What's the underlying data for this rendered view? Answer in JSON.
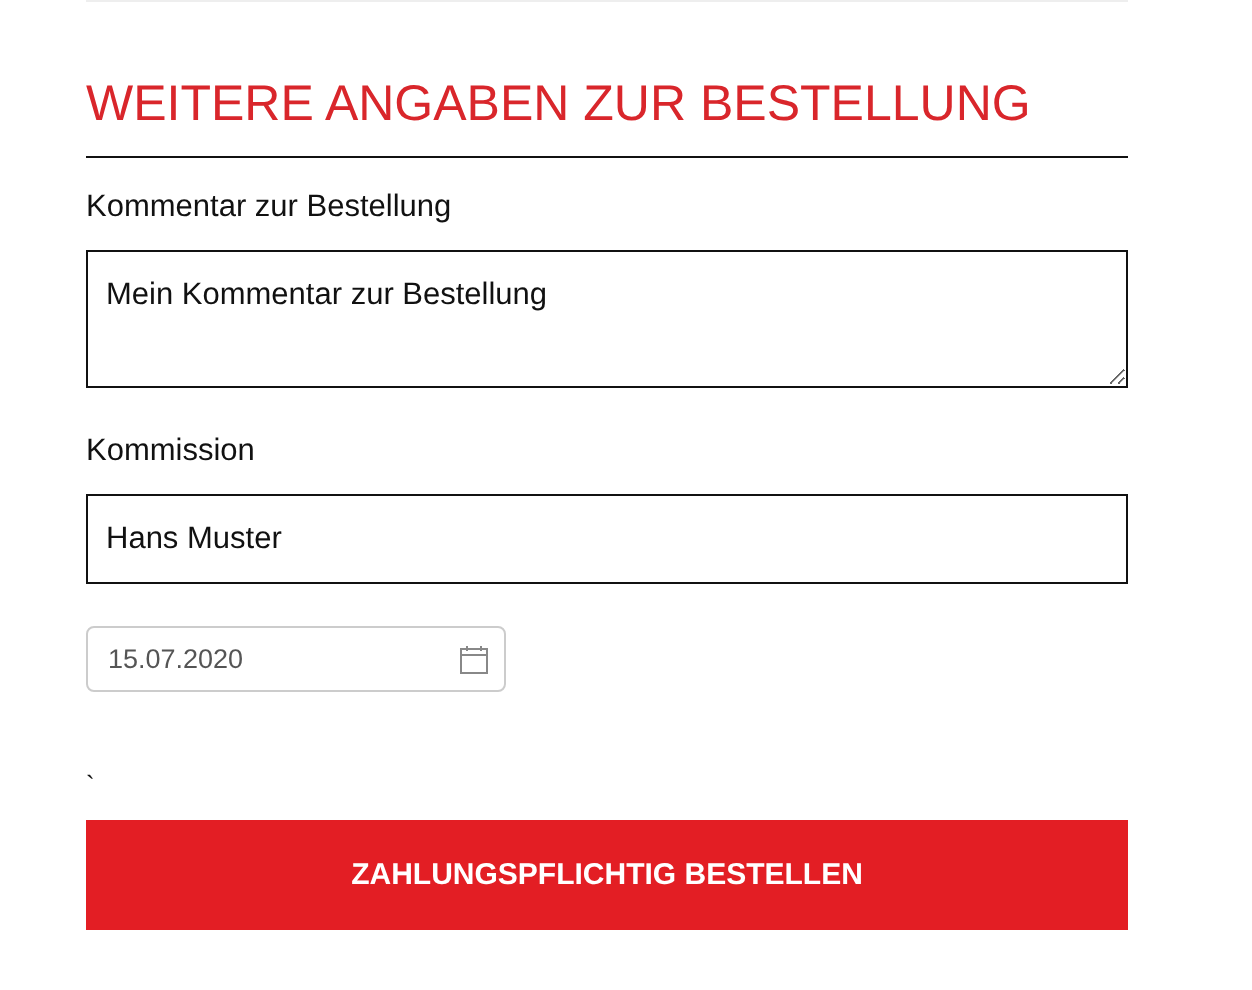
{
  "section_title": "WEITERE ANGABEN ZUR BESTELLUNG",
  "comment": {
    "label": "Kommentar zur Bestellung",
    "value": "Mein Kommentar zur Bestellung"
  },
  "commission": {
    "label": "Kommission",
    "value": "Hans Muster"
  },
  "date": {
    "value": "15.07.2020"
  },
  "stray_mark": "`",
  "submit_button": "ZAHLUNGSPFLICHTIG BESTELLEN"
}
